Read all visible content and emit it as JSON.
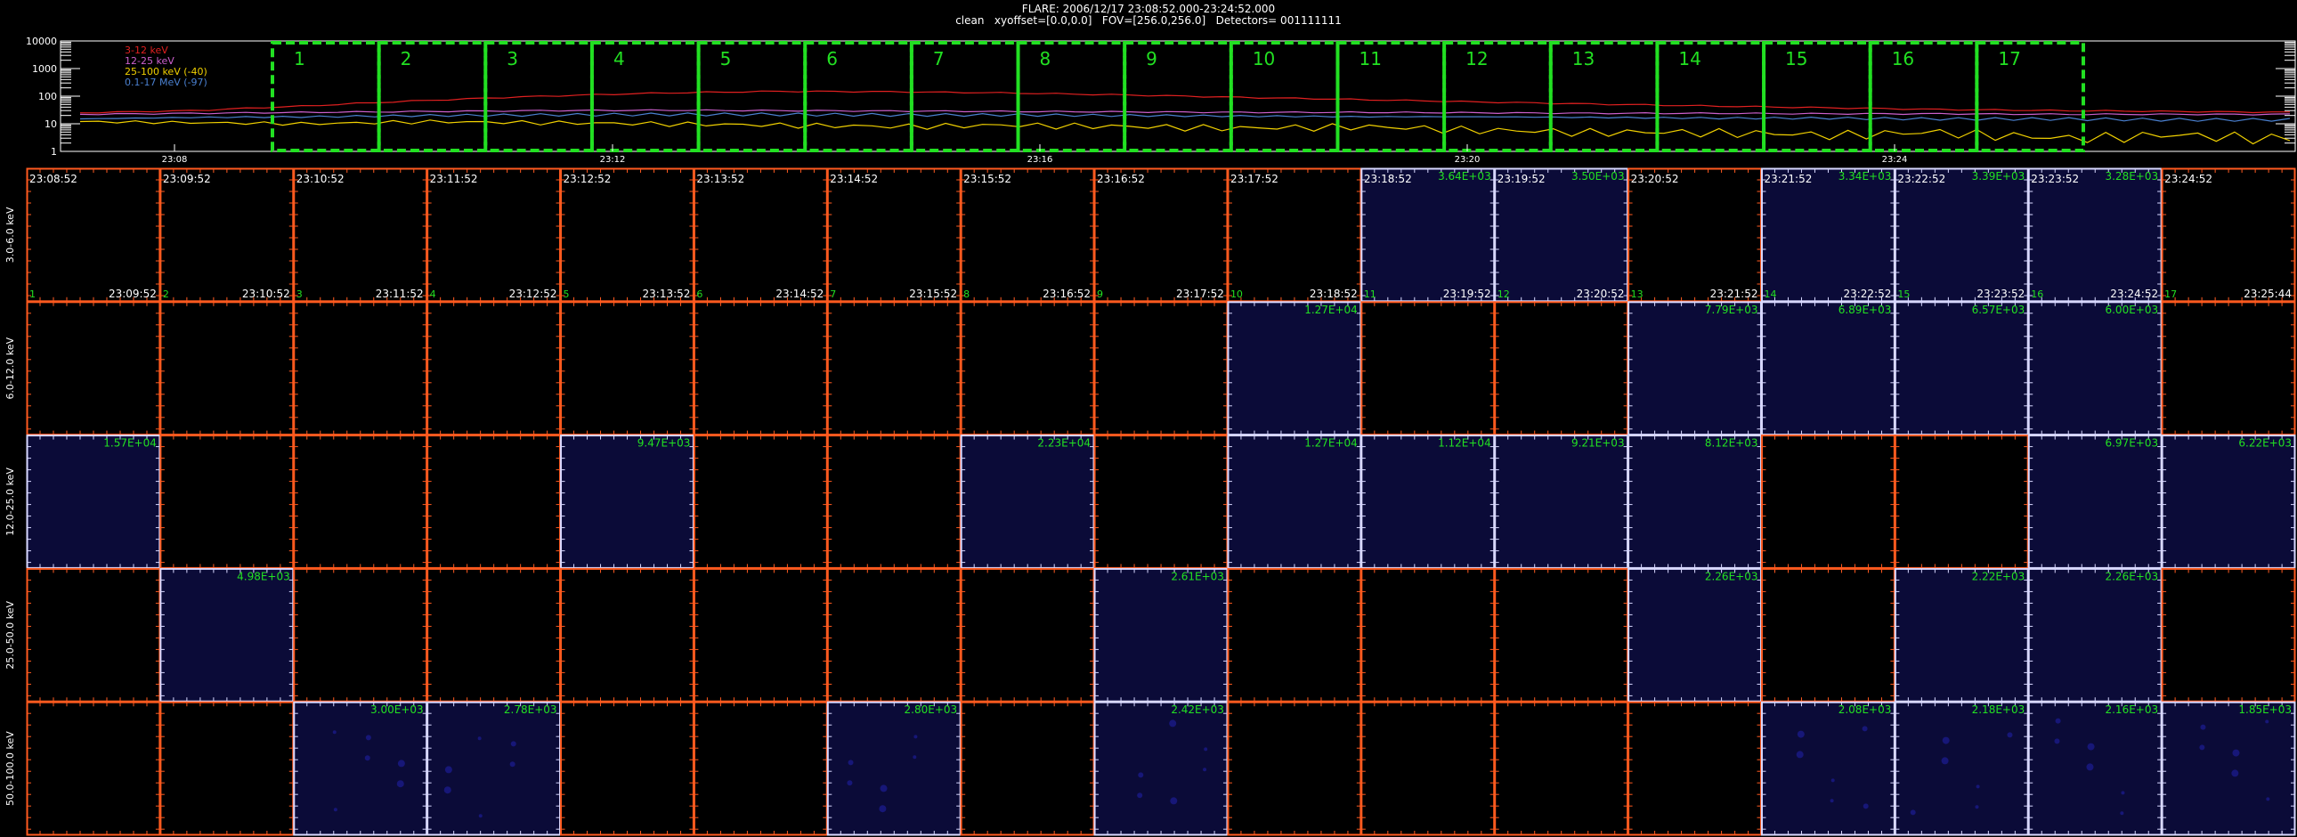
{
  "header": {
    "title": "FLARE: 2006/12/17 23:08:52.000-23:24:52.000",
    "subtitle": "clean   xyoffset=[0.0,0.0]   FOV=[256.0,256.0]   Detectors= 001111111"
  },
  "chart_data": [
    {
      "type": "line",
      "name": "lightcurve",
      "yscale": "log",
      "ylim": [
        1,
        10000
      ],
      "ytick_labels": [
        "1",
        "10",
        "100",
        "1000",
        "10000"
      ],
      "xtick_labels": [
        "23:08",
        "23:12",
        "23:16",
        "23:20",
        "23:24"
      ],
      "series": [
        {
          "name": "3-12 keV",
          "color": "#e02020",
          "values": [
            25,
            30,
            45,
            70,
            100,
            130,
            150,
            145,
            130,
            110,
            90,
            75,
            62,
            52,
            44,
            38,
            33,
            30,
            28,
            26
          ]
        },
        {
          "name": "12-25 keV",
          "color": "#cc60cc",
          "values": [
            22,
            24,
            26,
            28,
            30,
            31,
            30,
            29,
            28,
            27,
            26,
            26,
            25,
            24,
            24,
            23,
            23,
            22,
            22,
            22
          ]
        },
        {
          "name": "25-100 keV (-40)",
          "color": "#f0d000",
          "values": [
            12,
            11,
            10,
            12,
            11,
            10,
            9,
            8,
            9,
            8,
            7,
            8,
            6,
            5,
            5,
            4,
            5,
            3,
            4,
            3
          ]
        },
        {
          "name": "0.1-17 MeV (-97)",
          "color": "#4a80d0",
          "values": [
            15,
            17,
            18,
            20,
            21,
            22,
            22,
            21,
            21,
            20,
            19,
            18,
            18,
            17,
            16,
            16,
            15,
            15,
            14,
            14
          ]
        }
      ],
      "intervals": [
        "1",
        "2",
        "3",
        "4",
        "5",
        "6",
        "7",
        "8",
        "9",
        "10",
        "11",
        "12",
        "13",
        "14",
        "15",
        "16",
        "17"
      ]
    },
    {
      "type": "heatmap",
      "name": "image-grid",
      "rows": [
        "3.0-6.0 keV",
        "6.0-12.0 keV",
        "12.0-25.0 keV",
        "25.0-50.0 keV",
        "50.0-100.0 keV"
      ],
      "start_times": [
        "23:08:52",
        "23:09:52",
        "23:10:52",
        "23:11:52",
        "23:12:52",
        "23:13:52",
        "23:14:52",
        "23:15:52",
        "23:16:52",
        "23:17:52",
        "23:18:52",
        "23:19:52",
        "23:20:52",
        "23:21:52",
        "23:22:52",
        "23:23:52",
        "23:24:52"
      ],
      "end_times": [
        "23:09:52",
        "23:10:52",
        "23:11:52",
        "23:12:52",
        "23:13:52",
        "23:14:52",
        "23:15:52",
        "23:16:52",
        "23:17:52",
        "23:18:52",
        "23:19:52",
        "23:20:52",
        "23:21:52",
        "23:22:52",
        "23:23:52",
        "23:24:52",
        "23:25:44"
      ],
      "cell_numbers": [
        "1",
        "2",
        "3",
        "4",
        "5",
        "6",
        "7",
        "8",
        "9",
        "10",
        "11",
        "12",
        "13",
        "14",
        "15",
        "16",
        "17"
      ],
      "cells": [
        [
          null,
          null,
          null,
          null,
          null,
          null,
          null,
          null,
          null,
          null,
          "3.64E+03",
          "3.50E+03",
          null,
          "3.34E+03",
          "3.39E+03",
          "3.28E+03",
          null
        ],
        [
          null,
          null,
          null,
          null,
          null,
          null,
          null,
          null,
          null,
          "1.27E+04",
          null,
          null,
          "7.79E+03",
          "6.89E+03",
          "6.57E+03",
          "6.00E+03",
          null
        ],
        [
          "1.57E+04",
          null,
          null,
          null,
          "9.47E+03",
          null,
          null,
          "2.23E+04",
          null,
          "1.27E+04",
          "1.12E+04",
          "9.21E+03",
          "8.12E+03",
          null,
          null,
          "6.97E+03",
          "6.22E+03"
        ],
        [
          null,
          "4.98E+03",
          null,
          null,
          null,
          null,
          null,
          null,
          "2.61E+03",
          null,
          null,
          null,
          "2.26E+03",
          null,
          "2.22E+03",
          "2.26E+03",
          null
        ],
        [
          null,
          null,
          "3.00E+03",
          "2.78E+03",
          null,
          null,
          "2.80E+03",
          null,
          "2.42E+03",
          null,
          null,
          null,
          null,
          "2.08E+03",
          "2.18E+03",
          "2.16E+03",
          "1.85E+03"
        ]
      ]
    }
  ],
  "colors": {
    "background": "#000000",
    "grid_border": "#ff5a1f",
    "image_border": "#d8d8ff",
    "image_fill": "#0b0b38",
    "interval_box": "#22e022",
    "value_text": "#22e022"
  }
}
